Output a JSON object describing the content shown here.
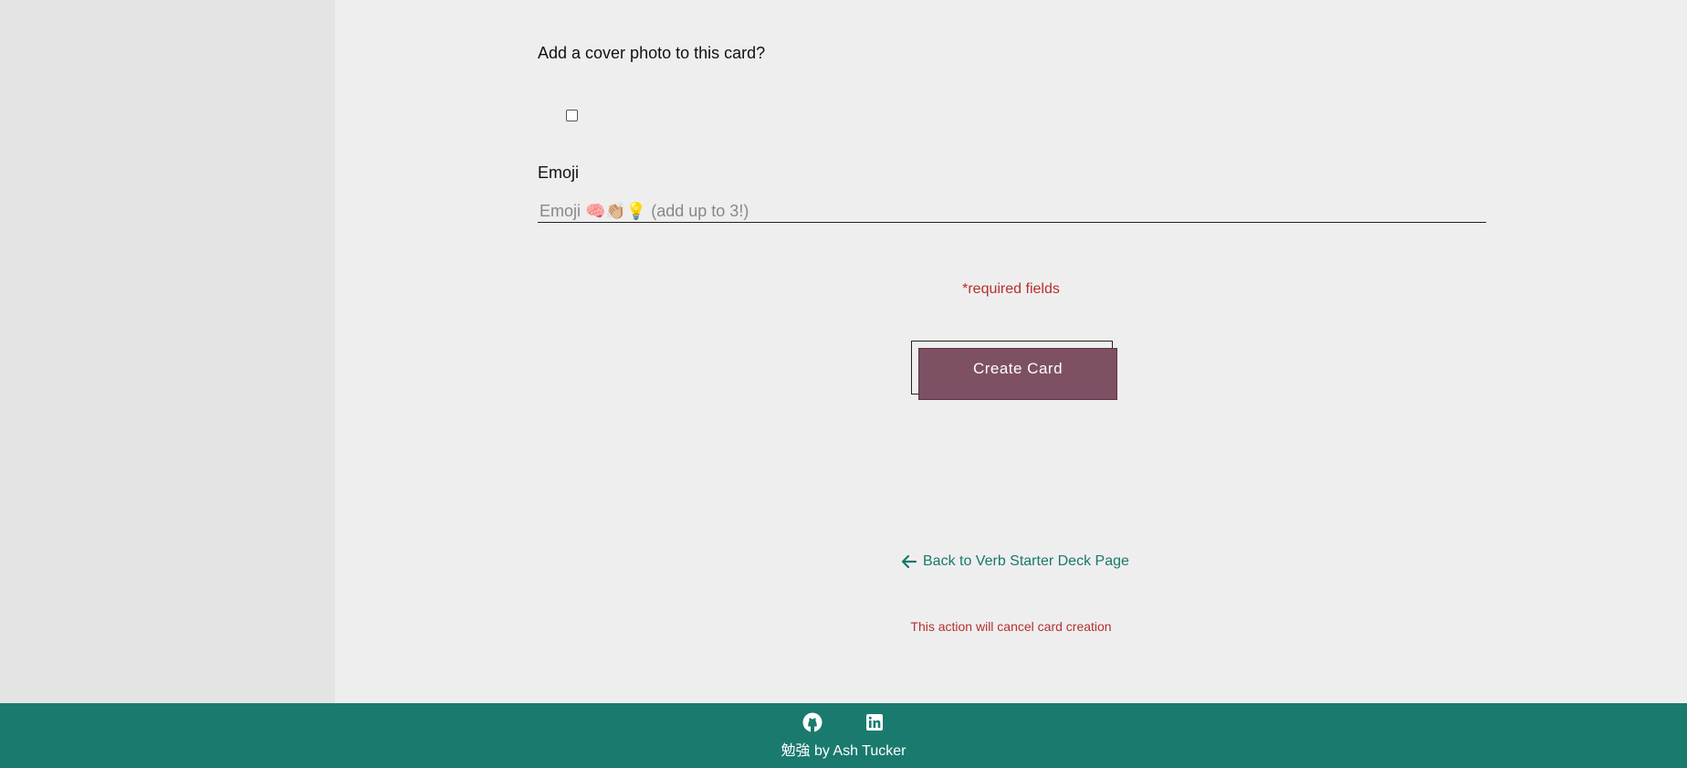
{
  "form": {
    "cover_photo_label": "Add a cover photo to this card?",
    "cover_photo_checked": false,
    "emoji_label": "Emoji",
    "emoji_placeholder": "Emoji 🧠👏🏼💡 (add up to 3!)",
    "emoji_value": "",
    "required_note": "*required fields",
    "submit_label": "Create Card"
  },
  "navigation": {
    "back_label": "Back to Verb Starter Deck Page",
    "back_icon": "arrow-left-icon",
    "cancel_note": "This action will cancel card creation"
  },
  "footer": {
    "icons": [
      "github-icon",
      "linkedin-icon"
    ],
    "credit": "勉強 by Ash Tucker"
  },
  "colors": {
    "accent_teal": "#1a7a6e",
    "link_teal": "#18786d",
    "button": "#7d5064",
    "warning_red": "#b3312f"
  }
}
